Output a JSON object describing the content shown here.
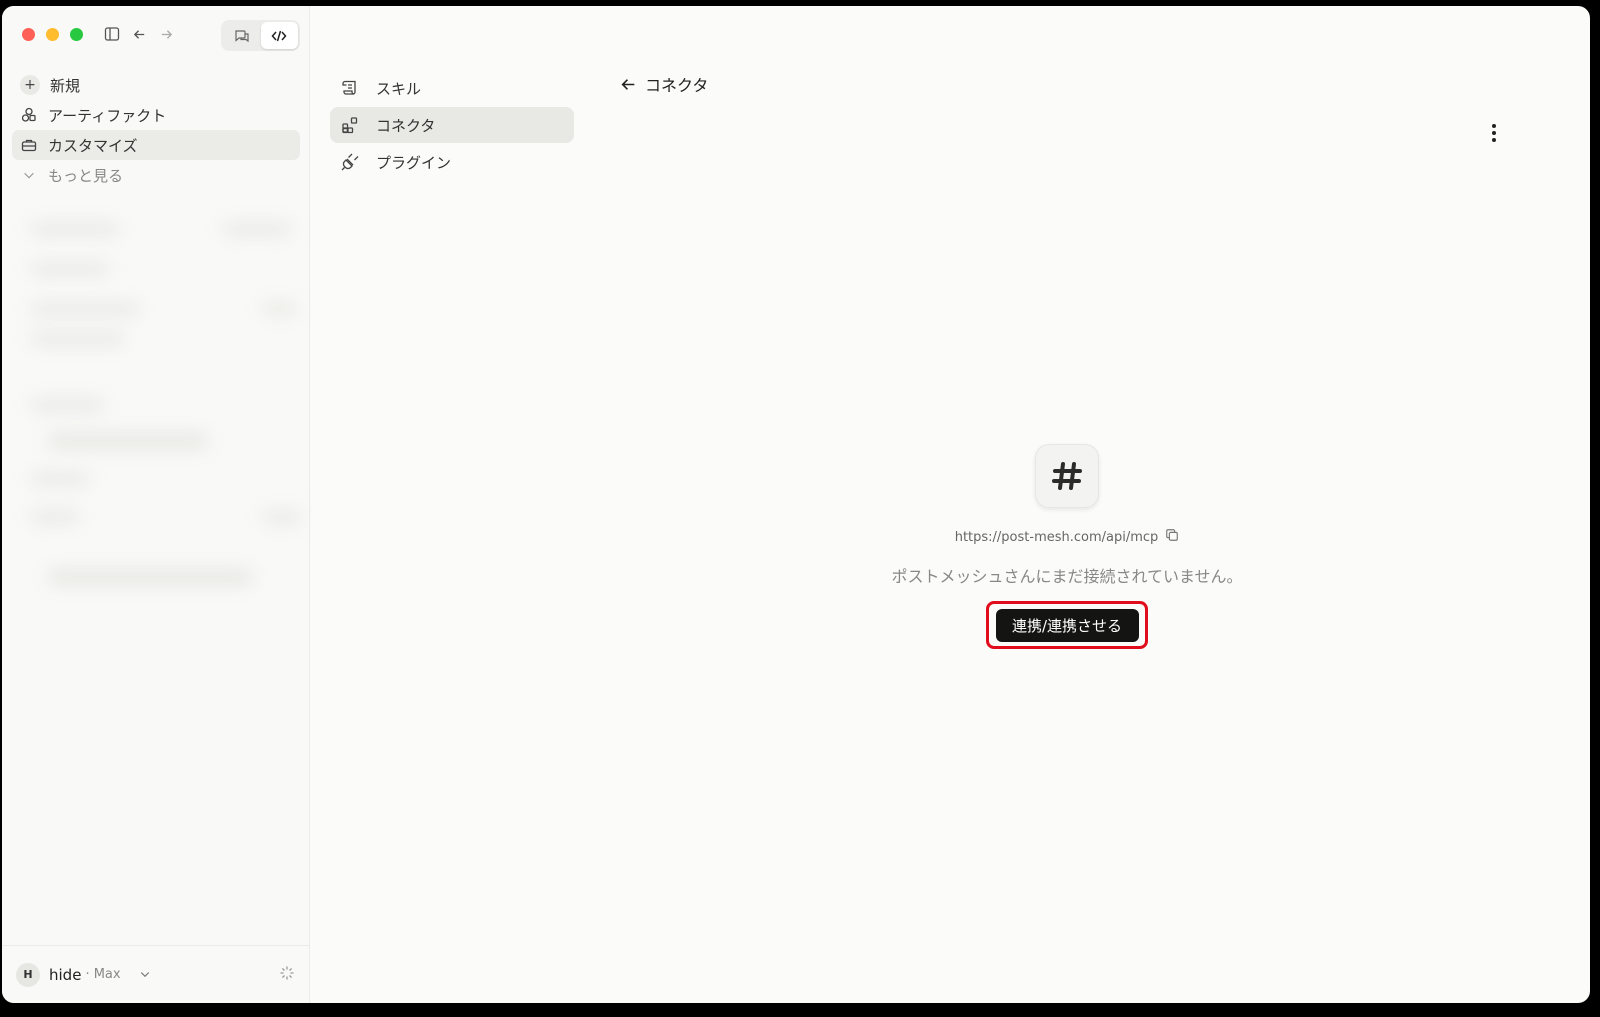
{
  "sidebar": {
    "items": [
      {
        "label": "新規"
      },
      {
        "label": "アーティファクト"
      },
      {
        "label": "カスタマイズ"
      },
      {
        "label": "もっと見る"
      }
    ],
    "user": {
      "initial": "H",
      "name": "hide",
      "plan": "· Max"
    }
  },
  "subnav": {
    "items": [
      {
        "label": "スキル"
      },
      {
        "label": "コネクタ"
      },
      {
        "label": "プラグイン"
      }
    ]
  },
  "main": {
    "back_label": "コネクタ",
    "url": "https://post-mesh.com/api/mcp",
    "status": "ポストメッシュさんにまだ接続されていません。",
    "connect_label": "連携/連携させる"
  },
  "colors": {
    "highlight": "#e10d1c",
    "button_bg": "#141413"
  }
}
